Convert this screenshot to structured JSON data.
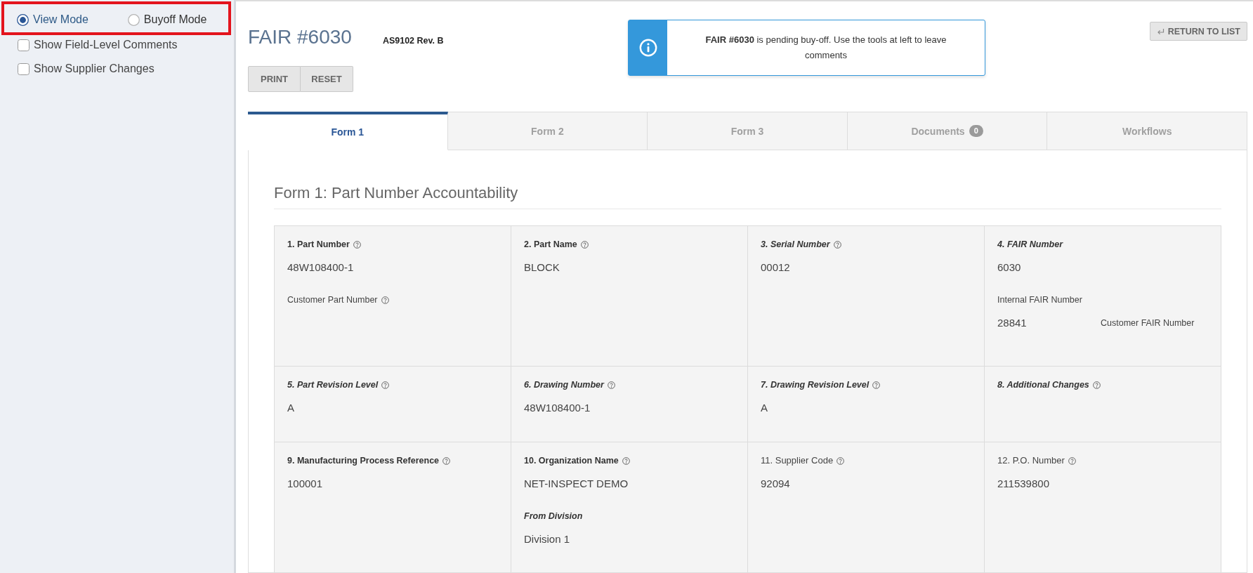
{
  "sidebar": {
    "highlight": true,
    "modes": [
      {
        "label": "View Mode",
        "selected": true
      },
      {
        "label": "Buyoff Mode",
        "selected": false
      }
    ],
    "options": [
      {
        "label": "Show Field-Level Comments",
        "checked": false
      },
      {
        "label": "Show Supplier Changes",
        "checked": false
      }
    ]
  },
  "header": {
    "title": "FAIR #6030",
    "standard": "AS9102 Rev. B",
    "buttons": [
      "PRINT",
      "RESET"
    ],
    "alert": {
      "text": "**FAIR #6030** is pending buy-off. Use the tools at left to leave comments"
    },
    "return_button": "RETURN TO LIST"
  },
  "tabs": [
    {
      "label": "Form 1",
      "selected": true
    },
    {
      "label": "Form 2",
      "selected": false
    },
    {
      "label": "Form 3",
      "selected": false
    },
    {
      "label": "Documents",
      "badge": "0",
      "selected": false
    },
    {
      "label": "Workflows",
      "selected": false
    }
  ],
  "form": {
    "heading": "Form 1: Part Number Accountability",
    "rows": [
      {
        "cells": [
          {
            "items": [
              {
                "kind": "label",
                "text": "1. Part Number",
                "help": true
              },
              {
                "kind": "value",
                "text": "48W108400-1"
              },
              {
                "kind": "sublabel",
                "text": "Customer Part Number",
                "help": true
              }
            ]
          },
          {
            "items": [
              {
                "kind": "label",
                "text": "2. Part Name",
                "help": true
              },
              {
                "kind": "value",
                "text": "BLOCK"
              }
            ]
          },
          {
            "items": [
              {
                "kind": "italic-label",
                "text": "3. Serial Number",
                "help": true
              },
              {
                "kind": "value",
                "text": "00012"
              }
            ]
          },
          {
            "items": [
              {
                "kind": "italic-label",
                "text": "4. FAIR Number",
                "help": false
              },
              {
                "kind": "value",
                "text": "6030"
              },
              {
                "kind": "sublabel",
                "text": "Internal FAIR Number",
                "help": false
              },
              {
                "kind": "pair",
                "value": "28841",
                "label": "Customer FAIR Number"
              }
            ]
          }
        ]
      },
      {
        "cells": [
          {
            "items": [
              {
                "kind": "italic-label",
                "text": "5. Part Revision Level",
                "help": true
              },
              {
                "kind": "value",
                "text": "A"
              }
            ]
          },
          {
            "items": [
              {
                "kind": "italic-label",
                "text": "6. Drawing Number",
                "help": true
              },
              {
                "kind": "value",
                "text": "48W108400-1"
              }
            ]
          },
          {
            "items": [
              {
                "kind": "italic-label",
                "text": "7. Drawing Revision Level",
                "help": true
              },
              {
                "kind": "value",
                "text": "A"
              }
            ]
          },
          {
            "items": [
              {
                "kind": "italic-label",
                "text": "8. Additional Changes",
                "help": true
              }
            ]
          }
        ]
      },
      {
        "cells": [
          {
            "items": [
              {
                "kind": "label",
                "text": "9. Manufacturing Process Reference",
                "help": true
              },
              {
                "kind": "value",
                "text": "100001"
              }
            ]
          },
          {
            "items": [
              {
                "kind": "label",
                "text": "10. Organization Name",
                "help": true
              },
              {
                "kind": "value",
                "text": "NET-INSPECT DEMO"
              },
              {
                "kind": "italic-label",
                "text": "From Division",
                "help": false
              },
              {
                "kind": "value",
                "text": "Division 1"
              }
            ]
          },
          {
            "items": [
              {
                "kind": "plain-label",
                "text": "11. Supplier Code",
                "help": true
              },
              {
                "kind": "value",
                "text": "92094"
              }
            ]
          },
          {
            "items": [
              {
                "kind": "plain-label",
                "text": "12. P.O. Number",
                "help": true
              },
              {
                "kind": "value",
                "text": "211539800"
              }
            ]
          }
        ]
      }
    ]
  }
}
